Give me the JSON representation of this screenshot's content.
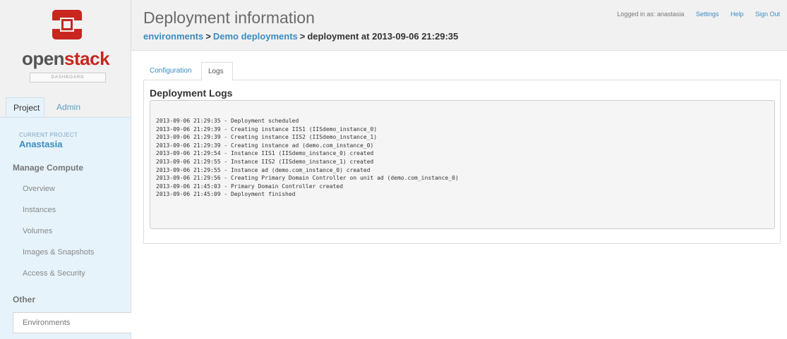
{
  "brand": {
    "name_open": "open",
    "name_stack": "stack",
    "subtitle": "DASHBOARD",
    "icon": "openstack-logo-icon",
    "accent_color": "#c8261f"
  },
  "sidebar": {
    "tabs": [
      {
        "label": "Project",
        "active": true
      },
      {
        "label": "Admin",
        "active": false
      }
    ],
    "current_project_label": "CURRENT PROJECT",
    "current_project_name": "Anastasia",
    "sections": [
      {
        "title": "Manage Compute",
        "items": [
          "Overview",
          "Instances",
          "Volumes",
          "Images & Snapshots",
          "Access & Security"
        ]
      },
      {
        "title": "Other",
        "items": [
          "Environments"
        ]
      }
    ],
    "active_item": "Environments"
  },
  "header": {
    "title": "Deployment information",
    "breadcrumb": [
      {
        "label": "environments",
        "link": true
      },
      {
        "label": "Demo deployments",
        "link": true
      },
      {
        "label": "deployment at 2013-09-06 21:29:35",
        "link": false
      }
    ],
    "breadcrumb_separator": ">",
    "logged_in_text": "Logged in as: anastasia",
    "links": [
      "Settings",
      "Help",
      "Sign Out"
    ]
  },
  "main": {
    "tabs": [
      {
        "label": "Configuration",
        "active": false
      },
      {
        "label": "Logs",
        "active": true
      }
    ],
    "logs_heading": "Deployment Logs",
    "log_lines": [
      "2013-09-06 21:29:35 - Deployment scheduled",
      "2013-09-06 21:29:39 - Creating instance IIS1 (IISdemo_instance_0)",
      "2013-09-06 21:29:39 - Creating instance IIS2 (IISdemo_instance_1)",
      "2013-09-06 21:29:39 - Creating instance ad (demo.com_instance_0)",
      "2013-09-06 21:29:54 - Instance IIS1 (IISdemo_instance_0) created",
      "2013-09-06 21:29:55 - Instance IIS2 (IISdemo_instance_1) created",
      "2013-09-06 21:29:55 - Instance ad (demo.com_instance_0) created",
      "2013-09-06 21:29:56 - Creating Primary Domain Controller on unit ad (demo.com_instance_0)",
      "2013-09-06 21:45:03 - Primary Domain Controller created",
      "2013-09-06 21:45:09 - Deployment finished"
    ]
  },
  "colors": {
    "link": "#3a8cc0",
    "sidebar_panel": "#e6f3fb",
    "header_bg": "#f1f1f1"
  }
}
